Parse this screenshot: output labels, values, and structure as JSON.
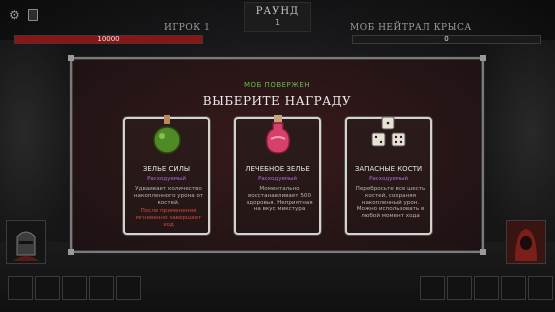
{
  "header": {
    "round_label": "РАУНД",
    "round_number": "1"
  },
  "player": {
    "name": "ИГРОК 1",
    "hp": "10000",
    "hp_fraction": 1.0
  },
  "enemy": {
    "name": "МОБ НЕЙТРАЛ КРЫСА",
    "hp": "0",
    "hp_fraction": 0.0
  },
  "modal": {
    "subtitle": "МОБ ПОВЕРЖЕН",
    "title": "ВЫБЕРИТЕ НАГРАДУ",
    "cards": [
      {
        "title": "ЗЕЛЬЕ СИЛЫ",
        "type": "Расходуемый",
        "desc": "Удваивает количество накопленного урона от костей.",
        "warning": "После применения мгновенно завершает ход",
        "icon": "green-potion-icon"
      },
      {
        "title": "ЛЕЧЕБНОЕ ЗЕЛЬЕ",
        "type": "Расходуемый",
        "desc": "Моментально восстанавливает 500 здоровья. Неприятная на вкус микстура",
        "warning": "",
        "icon": "pink-potion-icon"
      },
      {
        "title": "ЗАПАСНЫЕ КОСТИ",
        "type": "Расходуемый",
        "desc": "Перебросьте все шесть костей, сохраняя накопленный урон. Можно использовать в любой момент хода",
        "warning": "",
        "icon": "dice-icon"
      }
    ]
  },
  "colors": {
    "hp_bar": "#8b1414",
    "subtitle": "#5fbf4a",
    "type_tag": "#b46cd9",
    "warning": "#d24a3e"
  }
}
